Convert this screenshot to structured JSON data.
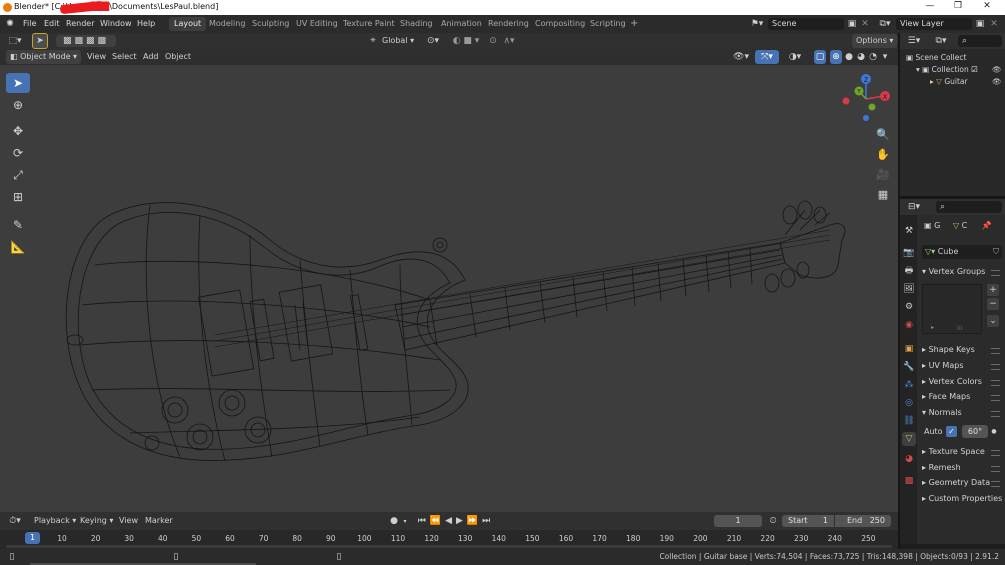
{
  "window": {
    "title_prefix": "Blender* [C:\\Users\\",
    "title_suffix": "\\Documents\\LesPaul.blend]",
    "controls": [
      "—",
      "❐",
      "✕"
    ]
  },
  "menu": [
    "File",
    "Edit",
    "Render",
    "Window",
    "Help"
  ],
  "workspaces": [
    "Layout",
    "Modeling",
    "Sculpting",
    "UV Editing",
    "Texture Paint",
    "Shading",
    "Animation",
    "Rendering",
    "Compositing",
    "Scripting"
  ],
  "active_workspace": "Layout",
  "add_workspace": "+",
  "scene": {
    "name": "Scene",
    "view_layer": "View Layer"
  },
  "toolbar": {
    "transform_orientation": "Global",
    "options_label": "Options"
  },
  "viewport_header": {
    "mode": "Object Mode",
    "menus": [
      "View",
      "Select",
      "Add",
      "Object"
    ]
  },
  "gizmo": {
    "x": "X",
    "y": "Y",
    "z": "Z"
  },
  "outliner": {
    "root": "Scene Collect",
    "collection": "Collection",
    "object": "Guitar"
  },
  "properties": {
    "tab_group": "G",
    "tab_c": "C",
    "mesh_name": "Cube",
    "sections": {
      "vertex_groups": "Vertex Groups",
      "shape_keys": "Shape Keys",
      "uv_maps": "UV Maps",
      "vertex_colors": "Vertex Colors",
      "face_maps": "Face Maps",
      "normals": "Normals",
      "texture_space": "Texture Space",
      "remesh": "Remesh",
      "geometry_data": "Geometry Data",
      "custom_properties": "Custom Properties"
    },
    "auto_label": "Auto",
    "auto_angle": "60°"
  },
  "timeline": {
    "menus": [
      "Playback",
      "Keying",
      "View",
      "Marker"
    ],
    "current_frame": "1",
    "start_label": "Start",
    "start": "1",
    "end_label": "End",
    "end": "250",
    "ticks": [
      "10",
      "20",
      "30",
      "40",
      "50",
      "60",
      "70",
      "80",
      "90",
      "100",
      "110",
      "120",
      "130",
      "140",
      "150",
      "160",
      "170",
      "180",
      "190",
      "200",
      "210",
      "220",
      "230",
      "240",
      "250"
    ],
    "current_marker": "1"
  },
  "status": "Collection | Guitar base | Verts:74,504 | Faces:73,725 | Tris:148,398 | Objects:0/93 | 2.91.2",
  "colors": {
    "accent": "#4772b3",
    "viewport": "#3d3d3d",
    "wire": "#101010"
  }
}
